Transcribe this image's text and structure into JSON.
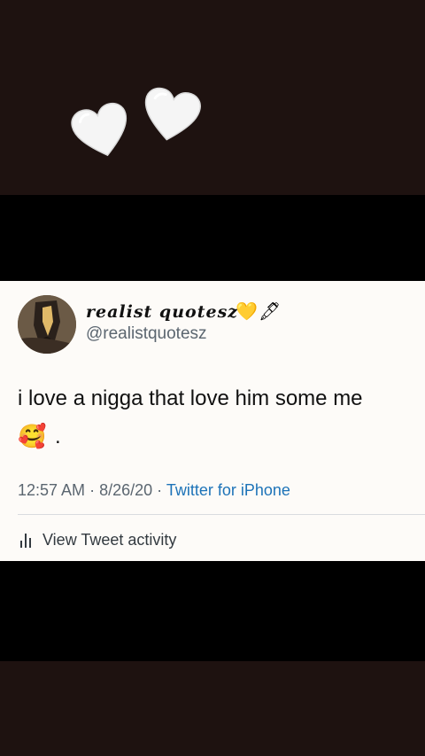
{
  "decor": {
    "hearts": [
      "white-heart-icon",
      "white-heart-icon"
    ]
  },
  "tweet": {
    "display_name": "realist quotesz",
    "name_emojis": [
      "💛",
      "🖋"
    ],
    "handle": "@realistquotesz",
    "text": "i love a nigga that love him some me",
    "emoji": "🥰",
    "trailing": ".",
    "time": "12:57 AM",
    "date": "8/26/20",
    "separator": "·",
    "source": "Twitter for iPhone",
    "activity_label": "View Tweet activity"
  },
  "colors": {
    "background_dark": "#1e1210",
    "card": "#fdfbf8",
    "link": "#1d73b8",
    "meta": "#5b6670"
  }
}
